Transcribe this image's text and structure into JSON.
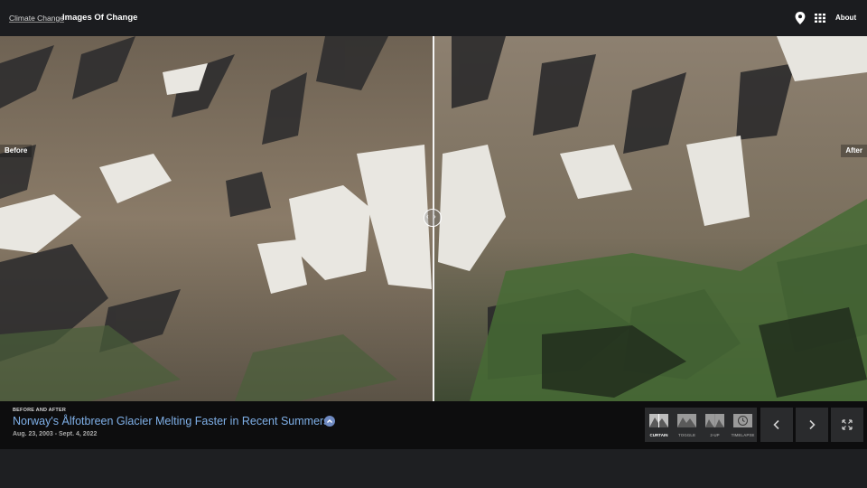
{
  "header": {
    "breadcrumb": "Climate Change",
    "title": "Images Of Change",
    "location_icon": "map-pin-icon",
    "grid_icon": "grid-icon",
    "about": "About"
  },
  "viewer": {
    "before_label": "Before",
    "after_label": "After",
    "handle_icon": "drag-handle-icon"
  },
  "caption": {
    "kicker": "BEFORE AND AFTER",
    "title": "Norway's Ålfotbreen Glacier Melting Faster in Recent Summers",
    "expand_icon": "chevron-up-icon",
    "dates": "Aug. 23, 2003 - Sept. 4, 2022"
  },
  "modes": [
    {
      "label": "CURTAIN",
      "icon": "curtain-icon",
      "active": true
    },
    {
      "label": "TOGGLE",
      "icon": "toggle-icon",
      "active": false
    },
    {
      "label": "2-UP",
      "icon": "two-up-icon",
      "active": false
    },
    {
      "label": "TIMELAPSE",
      "icon": "clock-icon",
      "active": false
    }
  ],
  "controls": {
    "prev_icon": "chevron-left-icon",
    "next_icon": "chevron-right-icon",
    "fullscreen_icon": "fullscreen-icon"
  }
}
